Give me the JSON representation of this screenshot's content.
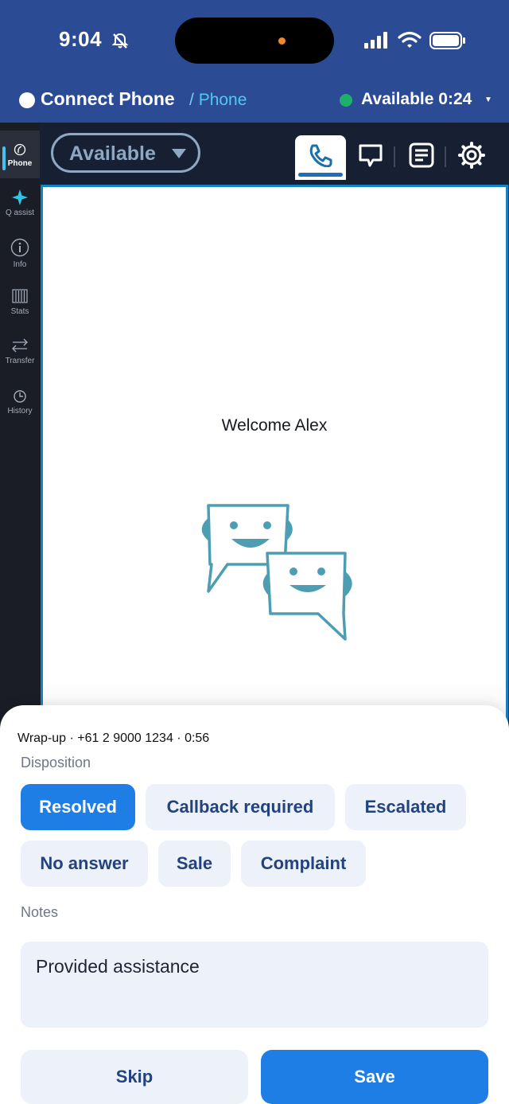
{
  "status_bar": {
    "time": "9:04",
    "icons": [
      "bell-slash-icon",
      "signal-icon",
      "wifi-icon",
      "battery-icon"
    ]
  },
  "header": {
    "app_name": "Connect Phone",
    "separator": "/",
    "section": "Phone",
    "availability": "Available 0:24",
    "availability_color": "#1faf6b"
  },
  "left_nav": {
    "items": [
      {
        "label": "Phone",
        "icon": "phone-handset-icon",
        "active": true
      },
      {
        "label": "Q assist",
        "icon": "sparkle-icon"
      },
      {
        "label": "Info",
        "icon": "info-icon"
      },
      {
        "label": "Stats",
        "icon": "stats-icon"
      },
      {
        "label": "Transfer",
        "icon": "transfer-icon"
      },
      {
        "label": "History",
        "icon": "history-icon"
      }
    ]
  },
  "toolbar": {
    "status_value": "Available",
    "tabs": [
      "phone-icon",
      "chat-icon",
      "notes-icon",
      "settings-gear-icon"
    ]
  },
  "main": {
    "welcome": "Welcome Alex"
  },
  "wrapup": {
    "info": "Wrap-up · +61 2 9000 1234 · 0:56",
    "disposition_label": "Disposition",
    "dispositions": [
      "Resolved",
      "Callback required",
      "Escalated",
      "No answer",
      "Sale",
      "Complaint"
    ],
    "selected": "Resolved",
    "notes_label": "Notes",
    "notes_value": "Provided assistance",
    "skip_label": "Skip",
    "save_label": "Save"
  },
  "colors": {
    "header_bg": "#2c4b95",
    "accent": "#1f7de6",
    "chip_bg": "#edf1fa",
    "chip_text": "#23437f",
    "bot_color": "#4d9db3"
  }
}
